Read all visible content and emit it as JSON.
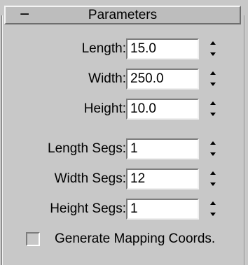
{
  "rollout": {
    "collapse_symbol": "−",
    "title": "Parameters"
  },
  "fields": [
    {
      "label": "Length:",
      "value": "15.0"
    },
    {
      "label": "Width:",
      "value": "250.0"
    },
    {
      "label": "Height:",
      "value": "10.0"
    },
    {
      "label": "Length Segs:",
      "value": "1"
    },
    {
      "label": "Width Segs:",
      "value": "12"
    },
    {
      "label": "Height Segs:",
      "value": "1"
    }
  ],
  "mapping": {
    "label": "Generate Mapping Coords.",
    "checked": false
  }
}
